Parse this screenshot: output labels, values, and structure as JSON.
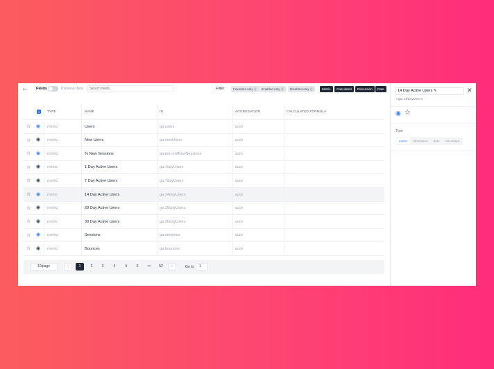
{
  "toolbar": {
    "back_icon": "arrow-left-icon",
    "fields_label": "Fields",
    "preview_label": "Preview data",
    "search_placeholder": "Search fields...",
    "filter_label": "Filter:",
    "chips": [
      {
        "label": "Favorites only ⓧ",
        "style": "light"
      },
      {
        "label": "Enabled only ⓧ",
        "style": "light"
      },
      {
        "label": "Disabled only ⓧ",
        "style": "light"
      },
      {
        "label": "Metric",
        "style": "dark"
      },
      {
        "label": "Calculated",
        "style": "dark"
      },
      {
        "label": "Dimension",
        "style": "dark"
      },
      {
        "label": "Date",
        "style": "dark"
      }
    ]
  },
  "table": {
    "headers": {
      "type": "TYPE",
      "name": "NAME",
      "id": "ID",
      "aggregation": "AGGREGATION",
      "formula": "CALCULATED FORMULA"
    },
    "rows": [
      {
        "type": "metric",
        "name": "Users",
        "id": "ga:users",
        "aggregation": "auto",
        "eye_color": "#3b82f6",
        "highlight": false
      },
      {
        "type": "metric",
        "name": "New Users",
        "id": "ga:newUsers",
        "aggregation": "auto",
        "eye_color": "#374151",
        "highlight": false
      },
      {
        "type": "metric",
        "name": "% New Sessions",
        "id": "ga:percentNewSessions",
        "aggregation": "auto",
        "eye_color": "#3b82f6",
        "highlight": false
      },
      {
        "type": "metric",
        "name": "1 Day Active Users",
        "id": "ga:1dayUsers",
        "aggregation": "auto",
        "eye_color": "#374151",
        "highlight": false
      },
      {
        "type": "metric",
        "name": "7 Day Active Users",
        "id": "ga:7dayUsers",
        "aggregation": "auto",
        "eye_color": "#374151",
        "highlight": false
      },
      {
        "type": "metric",
        "name": "14 Day Active Users",
        "id": "ga:14dayUsers",
        "aggregation": "auto",
        "eye_color": "#3b82f6",
        "highlight": true
      },
      {
        "type": "metric",
        "name": "28 Day Active Users",
        "id": "ga:28dayUsers",
        "aggregation": "auto",
        "eye_color": "#374151",
        "highlight": false
      },
      {
        "type": "metric",
        "name": "30 Day Active Users",
        "id": "ga:30dayUsers",
        "aggregation": "auto",
        "eye_color": "#374151",
        "highlight": false
      },
      {
        "type": "metric",
        "name": "Sessions",
        "id": "ga:sessions",
        "aggregation": "auto",
        "eye_color": "#3b82f6",
        "highlight": false
      },
      {
        "type": "metric",
        "name": "Bounces",
        "id": "ga:bounces",
        "aggregation": "auto",
        "eye_color": "#374151",
        "highlight": false
      }
    ]
  },
  "pagination": {
    "page_size": "10/page",
    "prev_icon": "chevron-left-icon",
    "next_icon": "chevron-right-icon",
    "pages": [
      "1",
      "2",
      "3",
      "4",
      "5",
      "6",
      "•••",
      "52"
    ],
    "active_page": "1",
    "goto_label": "Go to",
    "goto_value": "1"
  },
  "panel": {
    "name_value": "14 Day Active Users ✎",
    "field_id": "▸ga:14dayUsers",
    "type_label": "Type",
    "type_options": [
      "metric",
      "dimension",
      "date",
      "calculated"
    ],
    "selected_type": "metric",
    "close_icon": "close-icon",
    "eye_icon": "eye-icon",
    "star_icon": "star-icon"
  }
}
